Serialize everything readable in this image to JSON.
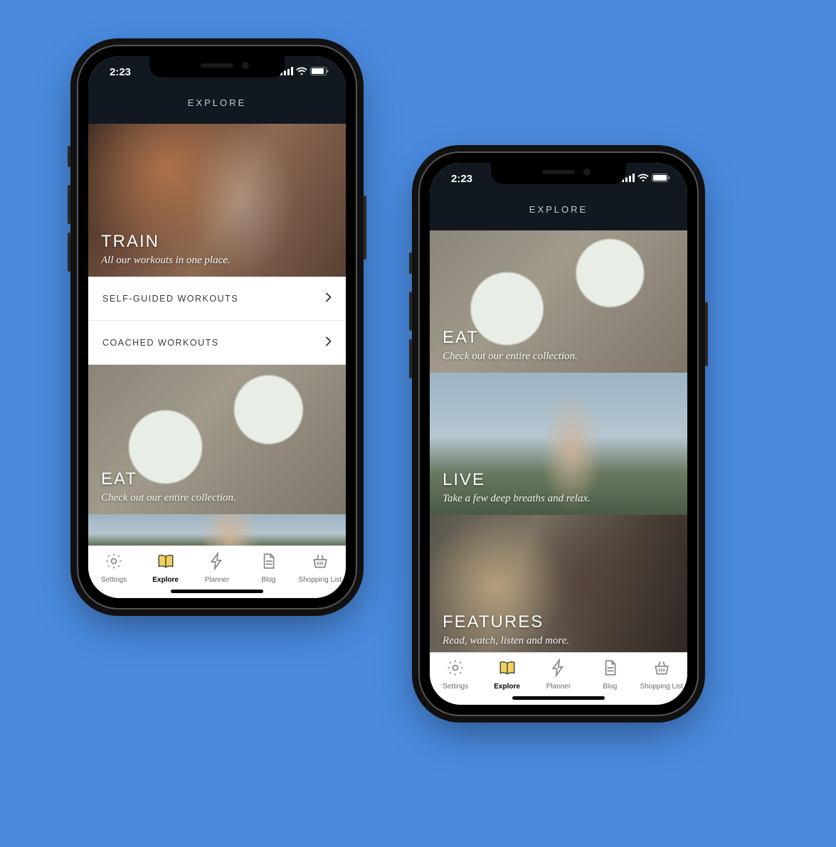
{
  "status": {
    "time": "2:23"
  },
  "header": {
    "title": "EXPLORE"
  },
  "cards": {
    "train": {
      "title": "TRAIN",
      "subtitle": "All our workouts in one place."
    },
    "eat": {
      "title": "EAT",
      "subtitle": "Check out our entire collection."
    },
    "live": {
      "title": "LIVE",
      "subtitle": "Take a few deep breaths and relax."
    },
    "features": {
      "title": "FEATURES",
      "subtitle": "Read, watch, listen and more."
    }
  },
  "rows": {
    "self_guided": "SELF-GUIDED WORKOUTS",
    "coached": "COACHED WORKOUTS"
  },
  "tabs": {
    "settings": "Settings",
    "explore": "Explore",
    "planner": "Planner",
    "blog": "Blog",
    "shopping": "Shopping List"
  }
}
